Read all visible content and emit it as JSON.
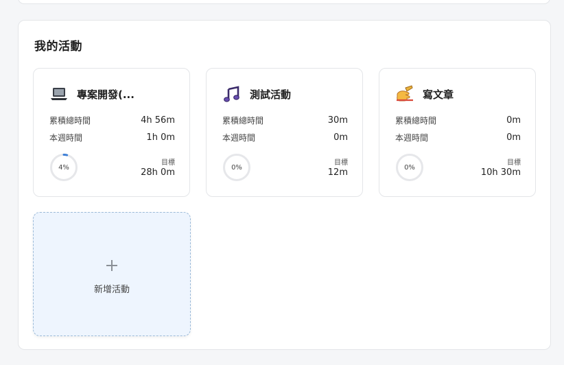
{
  "section": {
    "title": "我的活動"
  },
  "labels": {
    "total_time": "累積總時間",
    "week_time": "本週時間",
    "goal": "目標"
  },
  "activities": [
    {
      "name": "專案開發(...",
      "icon": "laptop-icon",
      "total": "4h 56m",
      "week": "1h 0m",
      "progress_text": "4%",
      "progress": 0.04,
      "goal": "28h 0m"
    },
    {
      "name": "測試活動",
      "icon": "music-note-icon",
      "total": "30m",
      "week": "0m",
      "progress_text": "0%",
      "progress": 0,
      "goal": "12m"
    },
    {
      "name": "寫文章",
      "icon": "writing-hand-icon",
      "total": "0m",
      "week": "0m",
      "progress_text": "0%",
      "progress": 0,
      "goal": "10h 30m"
    }
  ],
  "add_activity": {
    "label": "新增活動",
    "icon": "plus-icon"
  },
  "colors": {
    "progress_accent": "#3d7fd6",
    "ring_track": "#e6e7ea",
    "add_card_bg": "#eef5fe"
  }
}
